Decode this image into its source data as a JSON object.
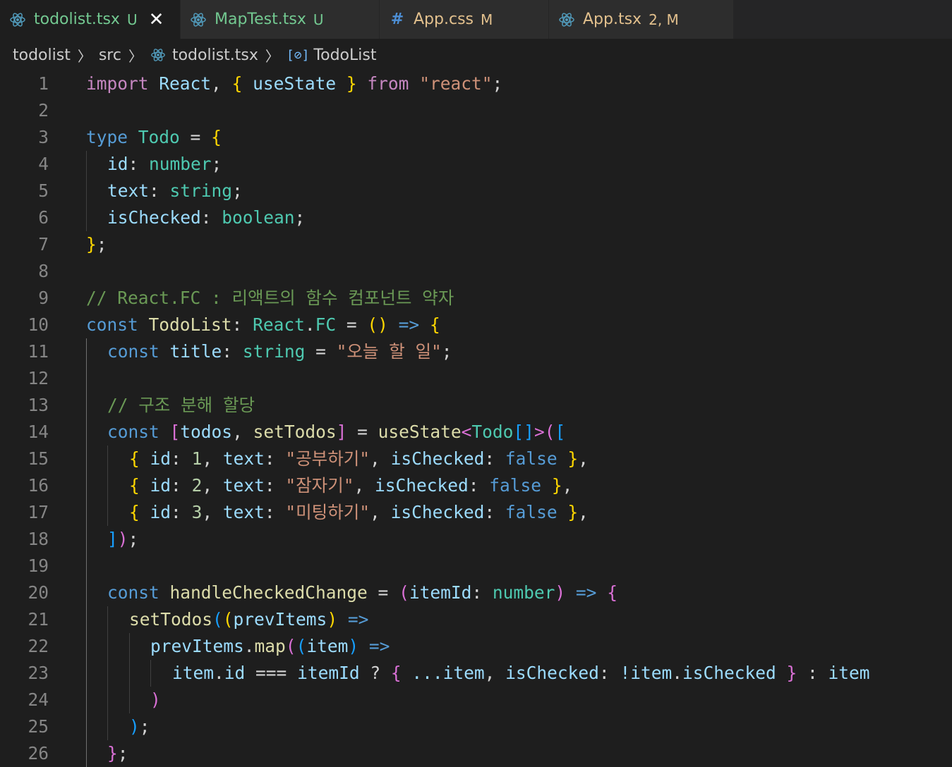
{
  "tabs": [
    {
      "name": "todolist.tsx",
      "status": "U",
      "icon": "react-icon",
      "active": true
    },
    {
      "name": "MapTest.tsx",
      "status": "U",
      "icon": "react-icon",
      "active": false
    },
    {
      "name": "App.css",
      "status": "M",
      "icon": "hash-icon",
      "active": false
    },
    {
      "name": "App.tsx",
      "status": "2, M",
      "icon": "react-icon",
      "active": false
    }
  ],
  "breadcrumb": {
    "folder": "todolist",
    "subfolder": "src",
    "file": "todolist.tsx",
    "symbol": "TodoList"
  },
  "line_numbers": [
    "1",
    "2",
    "3",
    "4",
    "5",
    "6",
    "7",
    "8",
    "9",
    "10",
    "11",
    "12",
    "13",
    "14",
    "15",
    "16",
    "17",
    "18",
    "19",
    "20",
    "21",
    "22",
    "23",
    "24",
    "25",
    "26"
  ],
  "code": {
    "l1": {
      "import": "import",
      "react": "React",
      "open": "{",
      "useState": "useState",
      "close": "}",
      "from": "from",
      "module": "\"react\""
    },
    "l3": {
      "type": "type",
      "name": "Todo",
      "open": "{"
    },
    "l4": {
      "prop": "id",
      "type": "number"
    },
    "l5": {
      "prop": "text",
      "type": "string"
    },
    "l6": {
      "prop": "isChecked",
      "type": "boolean"
    },
    "l7": {
      "close": "}"
    },
    "l9": {
      "comment": "// React.FC : 리액트의 함수 컴포넌트 약자"
    },
    "l10": {
      "const": "const",
      "name": "TodoList",
      "ns": "React",
      "fc": "FC",
      "open": "{"
    },
    "l11": {
      "const": "const",
      "name": "title",
      "type": "string",
      "value": "\"오늘 할 일\""
    },
    "l13": {
      "comment": "// 구조 분해 할당"
    },
    "l14": {
      "const": "const",
      "todos": "todos",
      "setTodos": "setTodos",
      "useState": "useState",
      "todo": "Todo"
    },
    "l15": {
      "id_key": "id",
      "id_val": "1",
      "text_key": "text",
      "text_val": "\"공부하기\"",
      "checked_key": "isChecked",
      "checked_val": "false"
    },
    "l16": {
      "id_key": "id",
      "id_val": "2",
      "text_key": "text",
      "text_val": "\"잠자기\"",
      "checked_key": "isChecked",
      "checked_val": "false"
    },
    "l17": {
      "id_key": "id",
      "id_val": "3",
      "text_key": "text",
      "text_val": "\"미팅하기\"",
      "checked_key": "isChecked",
      "checked_val": "false"
    },
    "l20": {
      "const": "const",
      "name": "handleCheckedChange",
      "param": "itemId",
      "type": "number"
    },
    "l21": {
      "call": "setTodos",
      "param": "prevItems"
    },
    "l22": {
      "obj": "prevItems",
      "method": "map",
      "param": "item"
    },
    "l23": {
      "item": "item",
      "id": "id",
      "itemId": "itemId",
      "spread": "...item",
      "checked_key": "isChecked",
      "neg_item": "!item",
      "neg_prop": "isChecked",
      "else": "item"
    }
  }
}
